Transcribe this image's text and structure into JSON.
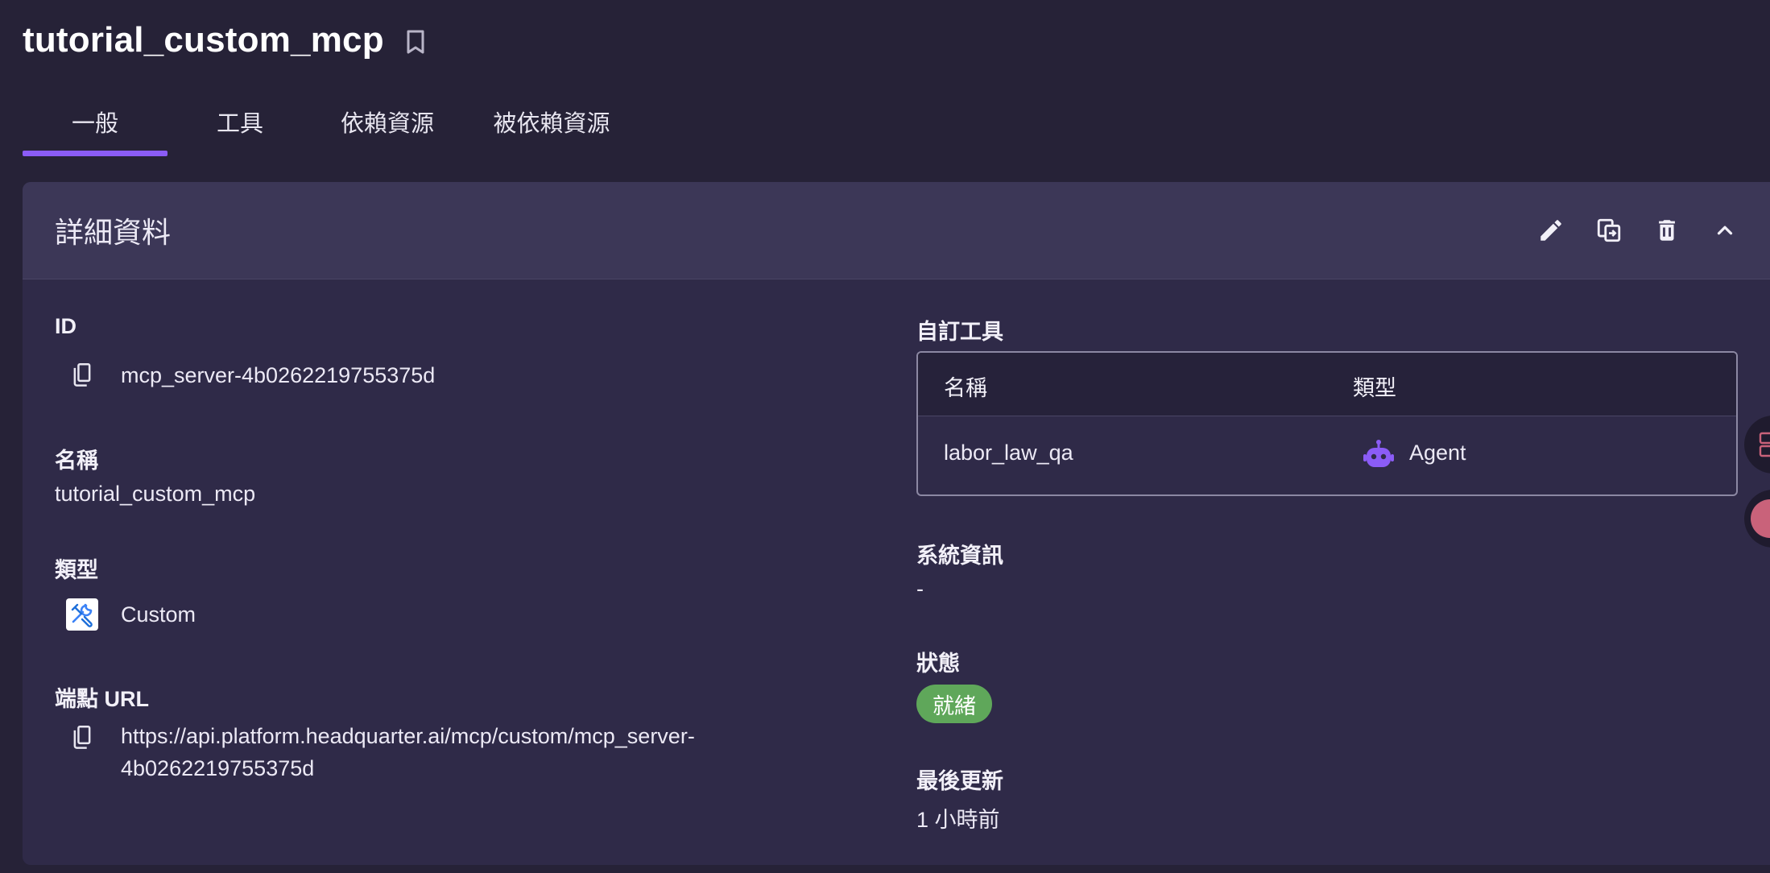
{
  "page": {
    "title": "tutorial_custom_mcp"
  },
  "tabs": [
    {
      "label": "一般",
      "active": true
    },
    {
      "label": "工具",
      "active": false
    },
    {
      "label": "依賴資源",
      "active": false
    },
    {
      "label": "被依賴資源",
      "active": false
    }
  ],
  "details": {
    "title": "詳細資料",
    "actions": [
      "pencil-icon",
      "duplicate-icon",
      "trash-icon",
      "chevron-up-icon"
    ],
    "id_label": "ID",
    "id_value": "mcp_server-4b0262219755375d",
    "name_label": "名稱",
    "name_value": "tutorial_custom_mcp",
    "type_label": "類型",
    "type_value": "Custom",
    "endpoint_label": "端點 URL",
    "endpoint_line1": "https://api.platform.headquarter.ai/mcp/custom/mcp_server-",
    "endpoint_line2": "4b0262219755375d",
    "custom_tools_label": "自訂工具",
    "tools_table": {
      "headers": [
        "名稱",
        "類型"
      ],
      "rows": [
        {
          "name": "labor_law_qa",
          "type": "Agent",
          "type_icon": "robot-icon"
        }
      ]
    },
    "system_info_label": "系統資訊",
    "system_info_value": "-",
    "status_label": "狀態",
    "status_value": "就緒",
    "last_updated_label": "最後更新",
    "last_updated_value": "1 小時前"
  },
  "colors": {
    "accent": "#8b5cf6",
    "status_ready": "#5fa75a",
    "background": "#262237",
    "card": "#2f2a48",
    "card_header": "#3c3757"
  }
}
